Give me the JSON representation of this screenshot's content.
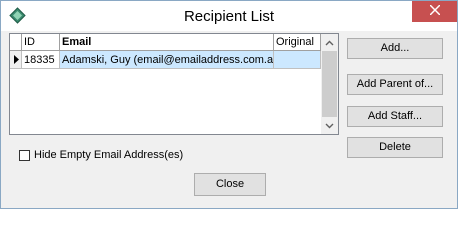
{
  "window": {
    "title": "Recipient List",
    "icon": "app-diamond-icon",
    "close_icon": "close-x-icon"
  },
  "grid": {
    "columns": [
      "ID",
      "Email",
      "Original"
    ],
    "rows": [
      {
        "id": "18335",
        "email": "Adamski, Guy (email@emailaddress.com.au)",
        "original": ""
      }
    ]
  },
  "buttons": {
    "add": "Add...",
    "add_parent": "Add Parent of...",
    "add_staff": "Add Staff...",
    "delete": "Delete",
    "close": "Close"
  },
  "options": {
    "hide_empty_label": "Hide Empty Email Address(es)",
    "hide_empty_checked": false
  },
  "colors": {
    "close_button_bg": "#c75050",
    "selection_bg": "#cce8ff"
  }
}
